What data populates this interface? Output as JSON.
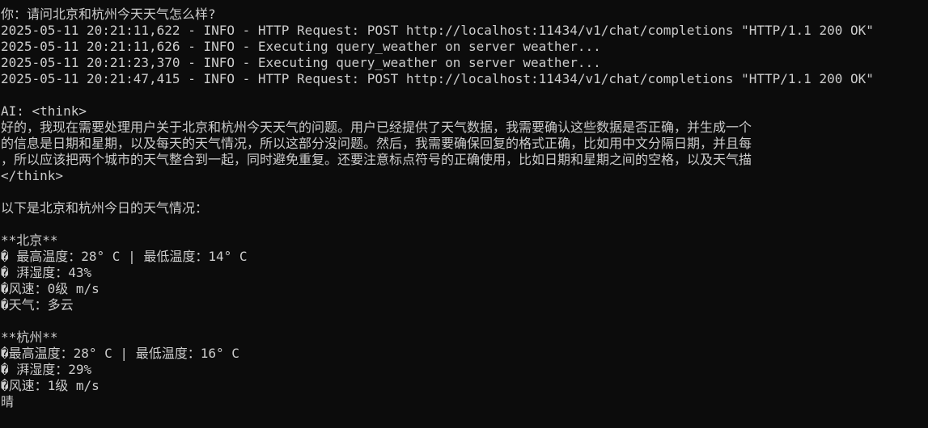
{
  "terminal": {
    "lines": [
      "你：请问北京和杭州今天天气怎么样?",
      "2025-05-11 20:21:11,622 - INFO - HTTP Request: POST http://localhost:11434/v1/chat/completions \"HTTP/1.1 200 OK\"",
      "2025-05-11 20:21:11,626 - INFO - Executing query_weather on server weather...",
      "2025-05-11 20:21:23,370 - INFO - Executing query_weather on server weather...",
      "2025-05-11 20:21:47,415 - INFO - HTTP Request: POST http://localhost:11434/v1/chat/completions \"HTTP/1.1 200 OK\"",
      "",
      "AI: <think>",
      "好的，我现在需要处理用户关于北京和杭州今天天气的问题。用户已经提供了天气数据，我需要确认这些数据是否正确，并生成一个",
      "的信息是日期和星期，以及每天的天气情况，所以这部分没问题。然后，我需要确保回复的格式正确，比如用中文分隔日期，并且每",
      "，所以应该把两个城市的天气整合到一起，同时避免重复。还要注意标点符号的正确使用，比如日期和星期之间的空格，以及天气描",
      "</think>",
      "",
      "以下是北京和杭州今日的天气情况：",
      "",
      "**北京**",
      "� 最高温度：28° C | 最低温度：14° C",
      "� 湃湿度：43%",
      "�风速：0级 m/s",
      "�天气：多云",
      "",
      "**杭州**",
      "�最高温度：28° C | 最低温度：16° C",
      "� 湃湿度：29%",
      "�风速：1级 m/s",
      "晴"
    ]
  }
}
